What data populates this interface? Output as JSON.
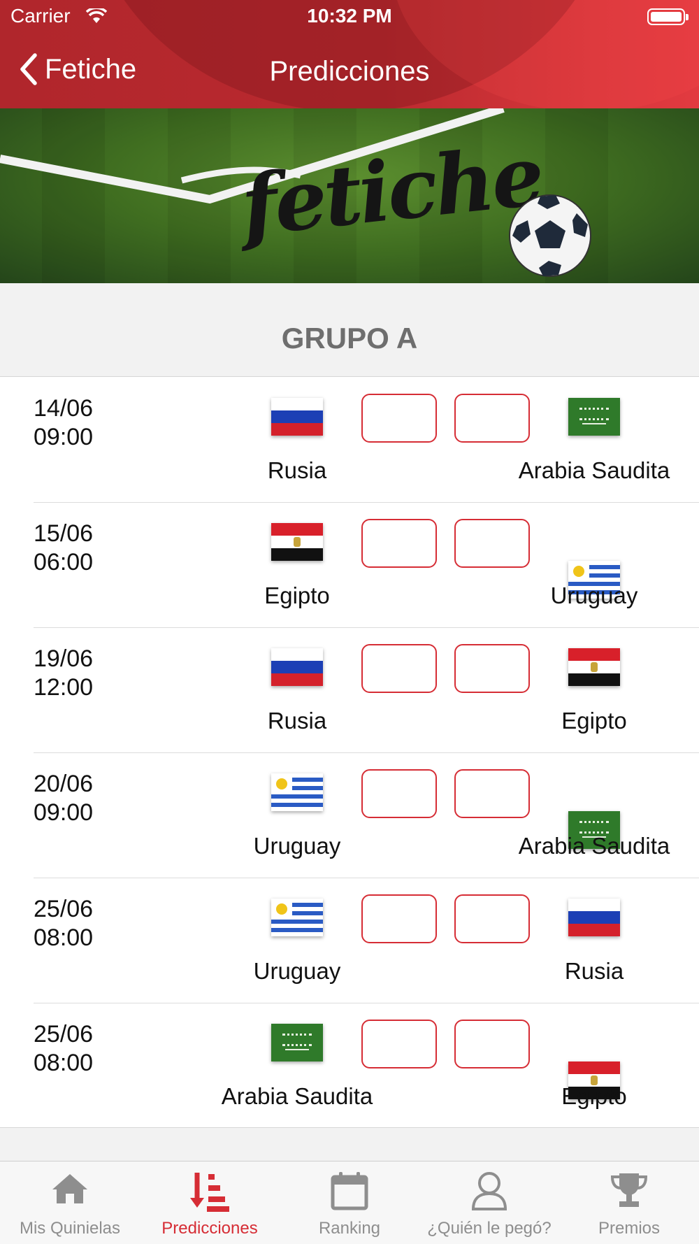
{
  "status_bar": {
    "carrier": "Carrier",
    "time": "10:32 PM"
  },
  "nav": {
    "back_label": "Fetiche",
    "title": "Predicciones"
  },
  "banner": {
    "logo_text": "fetiche"
  },
  "group": {
    "title": "GRUPO A"
  },
  "matches": [
    {
      "date": "14/06",
      "time": "09:00",
      "home": {
        "name": "Rusia",
        "flag": "russia-flag"
      },
      "away": {
        "name": "Arabia Saudita",
        "flag": "saudi-arabia-flag"
      }
    },
    {
      "date": "15/06",
      "time": "06:00",
      "home": {
        "name": "Egipto",
        "flag": "egypt-flag"
      },
      "away": {
        "name": "Uruguay",
        "flag": "uruguay-flag"
      }
    },
    {
      "date": "19/06",
      "time": "12:00",
      "home": {
        "name": "Rusia",
        "flag": "russia-flag"
      },
      "away": {
        "name": "Egipto",
        "flag": "egypt-flag"
      }
    },
    {
      "date": "20/06",
      "time": "09:00",
      "home": {
        "name": "Uruguay",
        "flag": "uruguay-flag"
      },
      "away": {
        "name": "Arabia Saudita",
        "flag": "saudi-arabia-flag"
      }
    },
    {
      "date": "25/06",
      "time": "08:00",
      "home": {
        "name": "Uruguay",
        "flag": "uruguay-flag"
      },
      "away": {
        "name": "Rusia",
        "flag": "russia-flag"
      }
    },
    {
      "date": "25/06",
      "time": "08:00",
      "home": {
        "name": "Arabia Saudita",
        "flag": "saudi-arabia-flag"
      },
      "away": {
        "name": "Egipto",
        "flag": "egypt-flag"
      }
    }
  ],
  "tabs": [
    {
      "label": "Mis Quinielas",
      "icon": "home-icon",
      "active": false
    },
    {
      "label": "Predicciones",
      "icon": "sort-down-icon",
      "active": true
    },
    {
      "label": "Ranking",
      "icon": "calendar-icon",
      "active": false
    },
    {
      "label": "¿Quién le pegó?",
      "icon": "user-icon",
      "active": false
    },
    {
      "label": "Premios",
      "icon": "trophy-icon",
      "active": false
    }
  ],
  "colors": {
    "header_red": "#b0262c",
    "accent_red": "#d62d35",
    "tab_inactive": "#8e8e8e"
  }
}
